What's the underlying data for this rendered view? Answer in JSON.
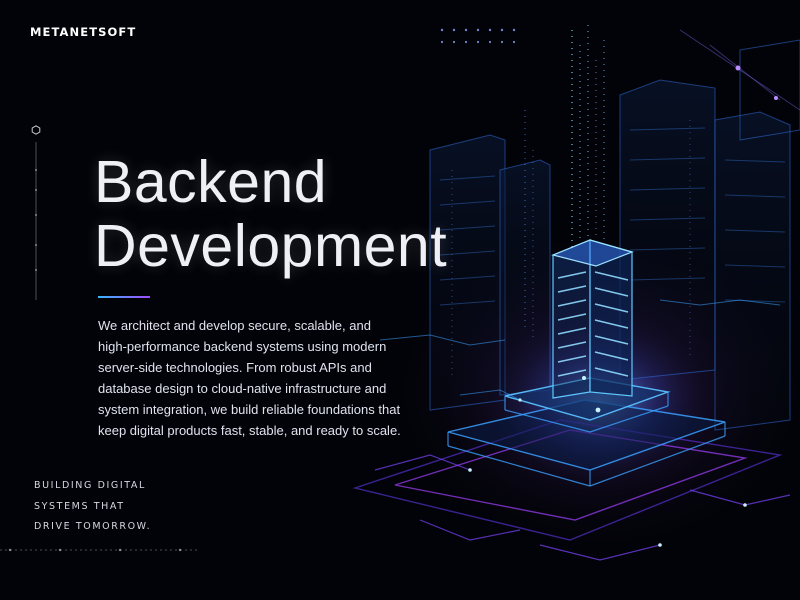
{
  "brand": {
    "name": "METANETSOFT"
  },
  "hero": {
    "title_lines": [
      "Backend",
      "Development"
    ],
    "description_lines": [
      "We architect and develop secure, scalable, and",
      "high-performance backend systems using modern",
      "server-side technologies. From robust APIs and",
      "database design to cloud-native infrastructure and",
      "system integration, we build reliable foundations that",
      "keep digital products fast, stable, and ready to scale."
    ]
  },
  "tagline": {
    "lines": [
      "BUILDING DIGITAL",
      "SYSTEMS THAT",
      "DRIVE TOMORROW."
    ]
  },
  "colors": {
    "background": "#020308",
    "accent_blue": "#37b6ff",
    "accent_purple": "#a24bff",
    "text": "#ffffff"
  },
  "icons": [
    "hexagon-icon",
    "server-tower-illustration"
  ]
}
